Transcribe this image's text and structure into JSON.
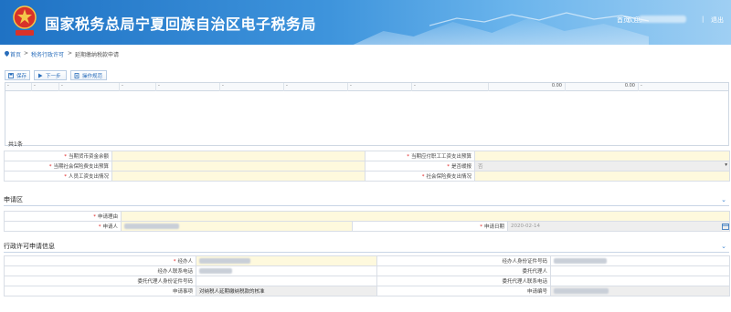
{
  "header": {
    "title": "国家税务总局宁夏回族自治区电子税务局",
    "nav_home": "首页",
    "nav_welcome": "欢迎,",
    "nav_sep": "|",
    "nav_logout": "退出"
  },
  "breadcrumb": {
    "home": "首页",
    "sep1": ">",
    "level1": "税务行政许可",
    "sep2": ">",
    "current": "延期缴纳税款申请"
  },
  "toolbar": {
    "save": "保存",
    "next": "下一步",
    "guide": "操作规范"
  },
  "grid": {
    "columns": [
      "-",
      "-",
      "-",
      "-",
      "-",
      "-",
      "-",
      "-",
      "-",
      "0.00",
      "0.00",
      "-"
    ],
    "total": "共1条"
  },
  "form1": {
    "rows": [
      {
        "l1": "当期货币资金余额",
        "r1": true,
        "l2": "当期应付职工工资支出预算",
        "r2": true
      },
      {
        "l1": "当期社会保险费支出预算",
        "r1": true,
        "l2": "是否缓报",
        "r2": true,
        "v2": "否"
      },
      {
        "l1": "人员工资支出情况",
        "r1": true,
        "l2": "社会保险费支出情况",
        "r2": true
      }
    ]
  },
  "apply_section": {
    "title": "申请区",
    "reason_label": "申请理由",
    "applicant_label": "申请人",
    "date_label": "申请日期",
    "date_value": "2020-02-14"
  },
  "license_section": {
    "title": "行政许可申请信息",
    "agent_label": "经办人",
    "agent_id_label": "经办人身份证件号码",
    "agent_phone_label": "经办人联系电话",
    "entrust_label": "委托代理人",
    "entrust_id_label": "委托代理人身份证件号码",
    "entrust_phone_label": "委托代理人联系电话",
    "matter_label": "申请事项",
    "matter_value": "对纳税人延期缴纳税款的核准",
    "apply_no_label": "申请编号"
  },
  "colors": {
    "header_start": "#1f72c4",
    "header_end": "#9fcff3",
    "link": "#2a6ebb",
    "required": "#e02020",
    "input_yellow": "#fef9dd",
    "input_gray": "#eeeeee"
  }
}
